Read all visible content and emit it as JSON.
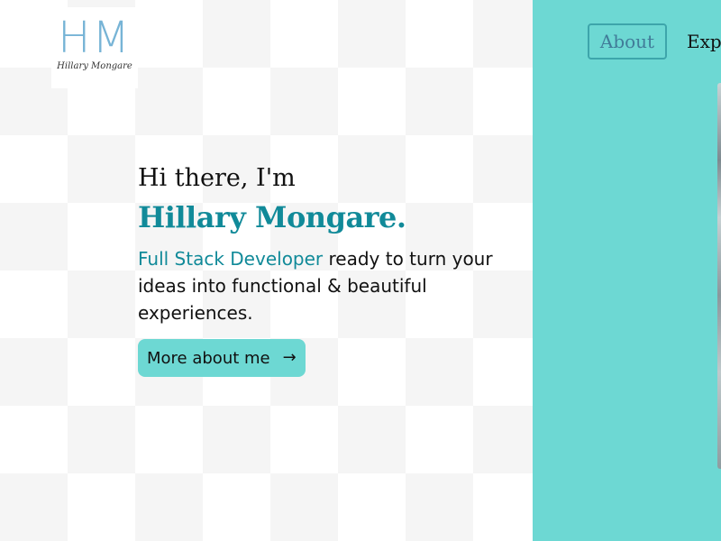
{
  "logo": {
    "mark": "HM",
    "subtitle": "Hillary Mongare"
  },
  "nav": {
    "about_label": "About",
    "experience_label": "Exp"
  },
  "hero": {
    "greeting": "Hi there, I'm",
    "name": "Hillary Mongare.",
    "role": "Full Stack Developer",
    "tagline_rest": " ready to turn your ideas into functional & beautiful experiences.",
    "cta_label": "More about me",
    "cta_icon": "arrow-right-icon"
  },
  "colors": {
    "accent_teal": "#6dd8d3",
    "heading_teal": "#118a99",
    "logo_blue": "#77b4d6"
  }
}
